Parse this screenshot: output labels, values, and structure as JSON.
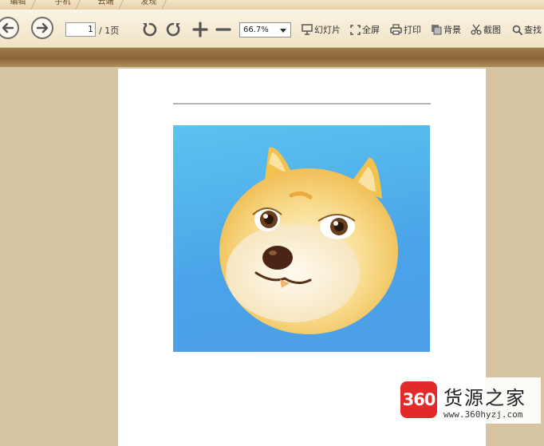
{
  "tabs": [
    {
      "label": "编辑"
    },
    {
      "label": "手机"
    },
    {
      "label": "云端"
    },
    {
      "label": "发现"
    }
  ],
  "toolbar": {
    "page_current": "1",
    "page_total": "/ 1页",
    "zoom": "66.7%",
    "tools": {
      "slideshow": "幻灯片",
      "fullscreen": "全屏",
      "print": "打印",
      "background": "背景",
      "screenshot": "截图",
      "search": "查找"
    }
  },
  "watermark": {
    "logo": "360",
    "title": "货源之家",
    "url": "www.360hyzj.com"
  },
  "colors": {
    "toolbar_bg": "#f6ecd6",
    "band": "#8b653a",
    "workarea": "#d6c3a0",
    "photo_bg": "#4aa3e8",
    "logo_red": "#e32a2a"
  },
  "icons": [
    "back-arrow-icon",
    "forward-arrow-icon",
    "rotate-left-icon",
    "rotate-right-icon",
    "zoom-in-icon",
    "zoom-out-icon",
    "slideshow-icon",
    "fullscreen-icon",
    "print-icon",
    "background-icon",
    "scissors-icon",
    "search-icon"
  ]
}
